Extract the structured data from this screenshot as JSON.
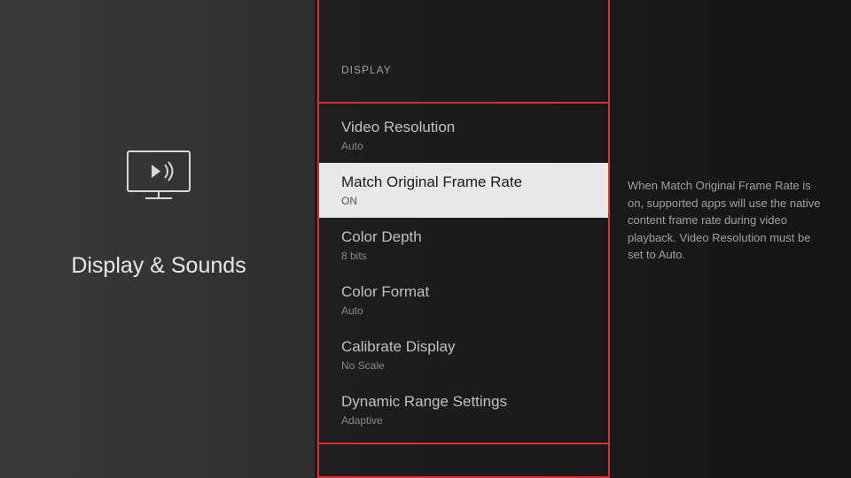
{
  "page_title": "Display & Sounds",
  "section_header": "DISPLAY",
  "menu_items": [
    {
      "title": "Video Resolution",
      "value": "Auto",
      "selected": false
    },
    {
      "title": "Match Original Frame Rate",
      "value": "ON",
      "selected": true
    },
    {
      "title": "Color Depth",
      "value": "8 bits",
      "selected": false
    },
    {
      "title": "Color Format",
      "value": "Auto",
      "selected": false
    },
    {
      "title": "Calibrate Display",
      "value": "No Scale",
      "selected": false
    },
    {
      "title": "Dynamic Range Settings",
      "value": "Adaptive",
      "selected": false
    }
  ],
  "description": "When Match Original Frame Rate is on, supported apps will use the native content frame rate during video playback. Video Resolution must be set to Auto.",
  "colors": {
    "highlight_border": "#d83131",
    "selected_bg": "#e8e8e8"
  }
}
